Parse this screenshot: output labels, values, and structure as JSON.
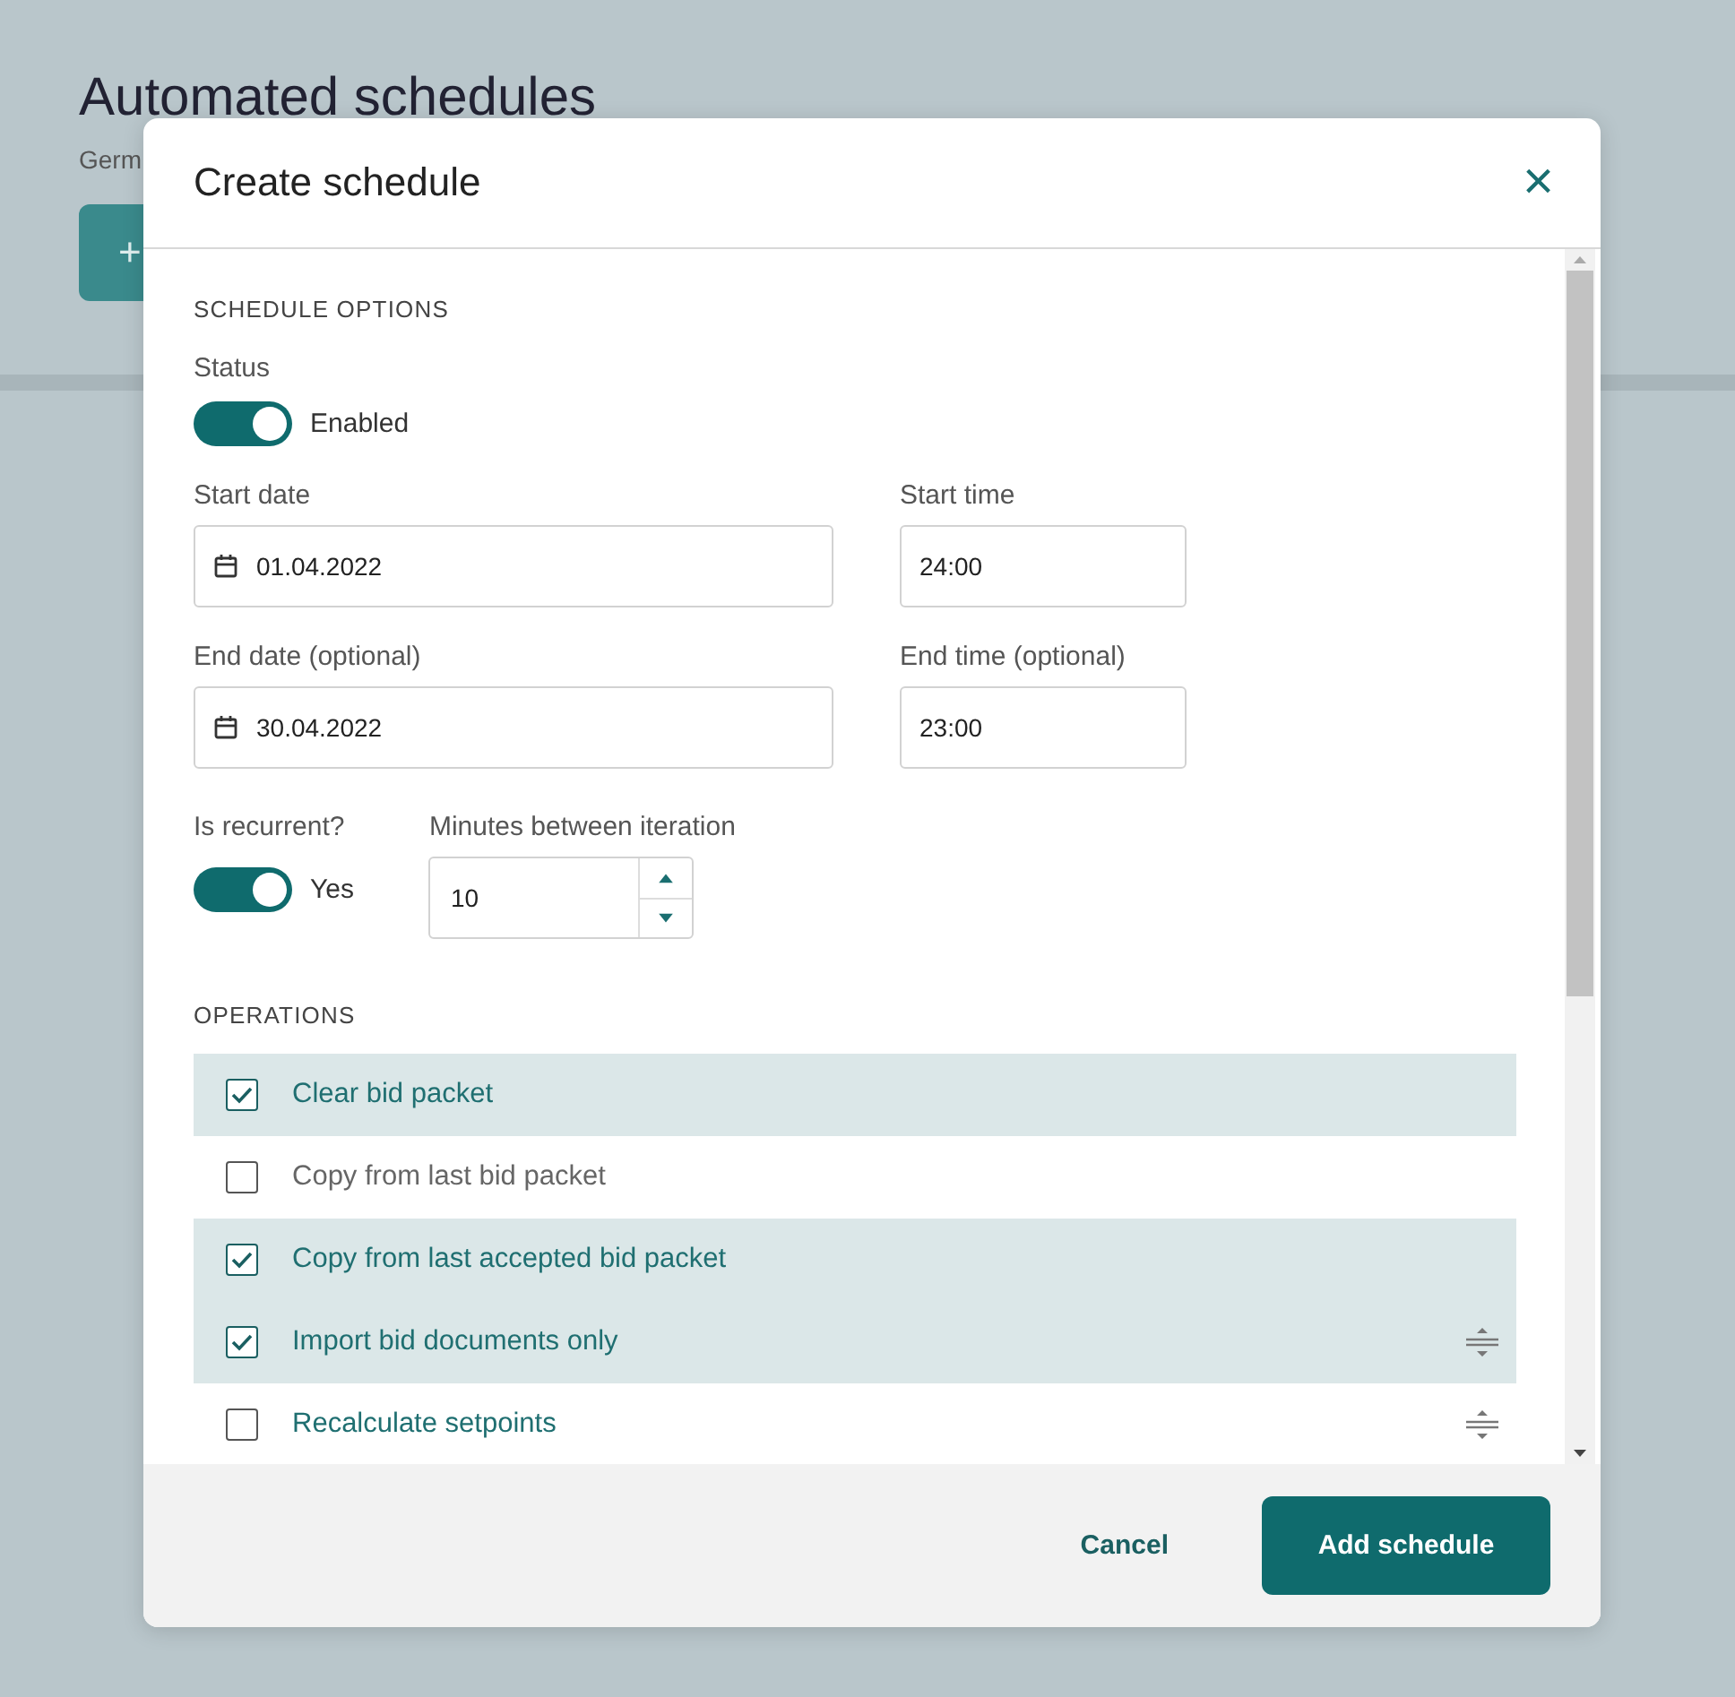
{
  "page": {
    "title": "Automated schedules",
    "subtitle": "Germ",
    "add_button": "+"
  },
  "dialog": {
    "title": "Create schedule",
    "close": "×",
    "section_options": "SCHEDULE OPTIONS",
    "status": {
      "label": "Status",
      "on": true,
      "text": "Enabled"
    },
    "start_date": {
      "label": "Start date",
      "value": "01.04.2022"
    },
    "start_time": {
      "label": "Start time",
      "value": "24:00"
    },
    "end_date": {
      "label": "End date (optional)",
      "value": "30.04.2022"
    },
    "end_time": {
      "label": "End time (optional)",
      "value": "23:00"
    },
    "recurrent": {
      "label": "Is recurrent?",
      "on": true,
      "text": "Yes"
    },
    "minutes": {
      "label": "Minutes between iteration",
      "value": "10"
    },
    "section_operations": "OPERATIONS",
    "operations": [
      {
        "label": "Clear bid packet",
        "checked": true,
        "disabled": false,
        "draggable": false
      },
      {
        "label": "Copy from last bid packet",
        "checked": false,
        "disabled": true,
        "draggable": false
      },
      {
        "label": "Copy from last accepted bid packet",
        "checked": true,
        "disabled": false,
        "draggable": false
      },
      {
        "label": "Import bid documents only",
        "checked": true,
        "disabled": false,
        "draggable": true
      },
      {
        "label": "Recalculate setpoints",
        "checked": false,
        "disabled": false,
        "draggable": true
      }
    ],
    "buttons": {
      "cancel": "Cancel",
      "submit": "Add schedule"
    }
  }
}
